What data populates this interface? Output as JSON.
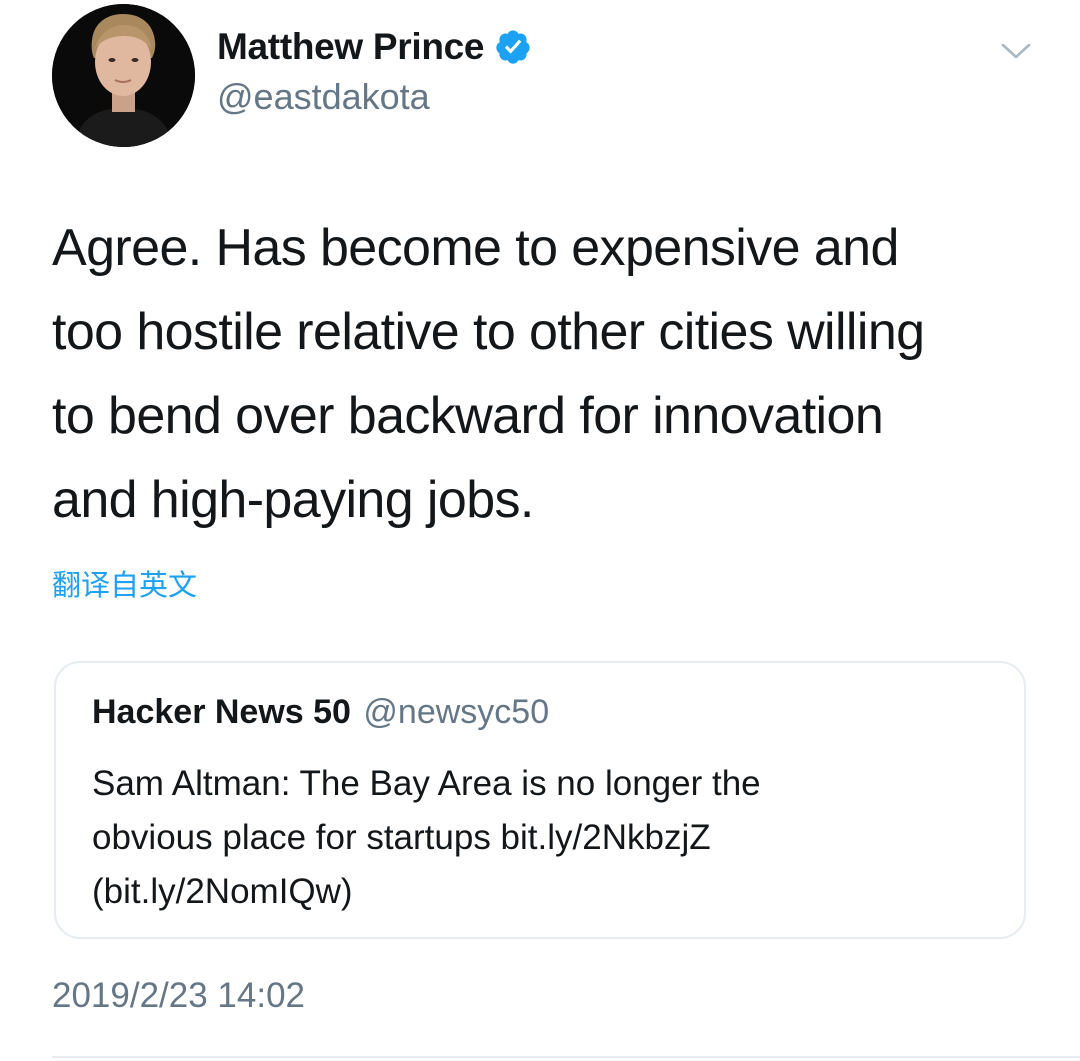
{
  "author": {
    "display_name": "Matthew Prince",
    "handle": "@eastdakota",
    "verified": true,
    "avatar_icon": "profile-photo"
  },
  "tweet": {
    "text": "Agree. Has become to expensive and\ntoo hostile relative to other cities willing\nto bend over backward for innovation\nand high-paying jobs.",
    "translate_label": "翻译自英文",
    "timestamp": "2019/2/23 14:02"
  },
  "quoted_tweet": {
    "display_name": "Hacker News 50",
    "handle": "@newsyc50",
    "text": "Sam Altman: The Bay Area is no longer the\nobvious place for startups bit.ly/2NkbzjZ\n(bit.ly/2NomIQw)"
  },
  "icons": {
    "verified": "verified-badge-icon",
    "menu": "chevron-down-icon"
  },
  "colors": {
    "accent": "#1da1f2",
    "text_primary": "#14171a",
    "text_secondary": "#657786",
    "border": "#e6ecf0"
  }
}
